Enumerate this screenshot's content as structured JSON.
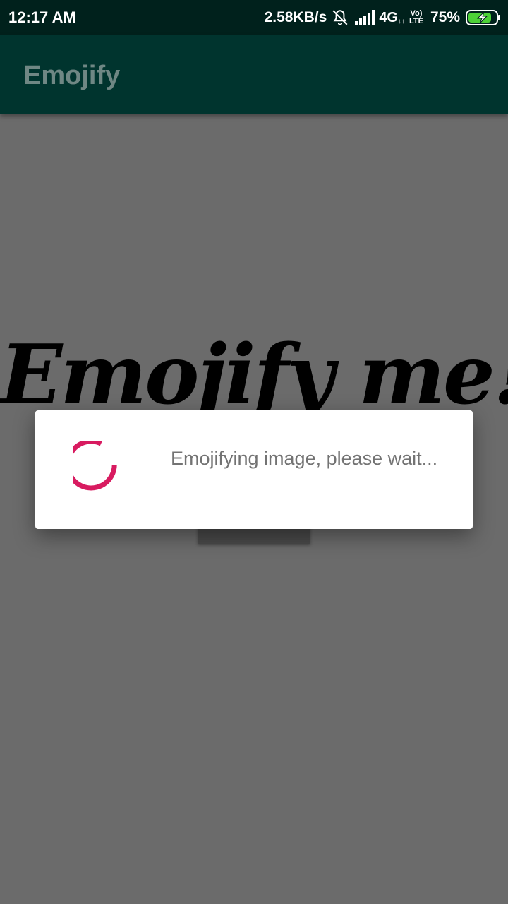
{
  "status_bar": {
    "time": "12:17 AM",
    "speed": "2.58KB/s",
    "network": "4G",
    "volte_top": "Vo)",
    "volte_bottom": "LTE",
    "battery": "75%",
    "icons": [
      "bell-off-icon",
      "signal-icon",
      "data-arrows-icon",
      "volte-icon",
      "battery-charging-icon"
    ]
  },
  "app_bar": {
    "title": "Emojify"
  },
  "main": {
    "hero_text": "Emojify me!"
  },
  "dialog": {
    "message": "Emojifying image, please wait..."
  },
  "colors": {
    "status_bar": "#00211c",
    "app_bar": "#00342e",
    "scrim": "#6b6b6b",
    "spinner": "#d81b60",
    "battery_fill": "#4cd137"
  }
}
